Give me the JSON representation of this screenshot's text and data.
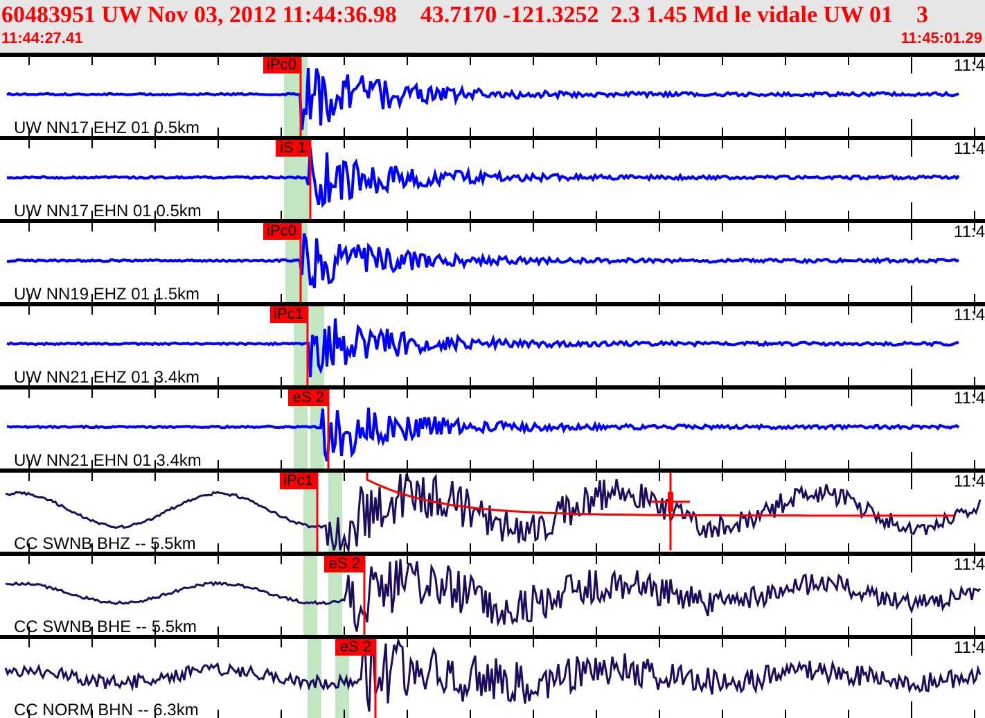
{
  "header": {
    "title": "60483951 UW Nov 03, 2012 11:44:36.98    43.7170 -121.3252  2.3 1.45 Md le vidale UW 01    3",
    "start_time": "11:44:27.41",
    "end_time": "11:45:01.29"
  },
  "channels": [
    {
      "kind": "short_period",
      "station": "UW NN17 EHZ 01 0.5km",
      "pick": "iPc0",
      "time_label": "11:4",
      "color": "#0000ff"
    },
    {
      "kind": "short_period",
      "station": "UW NN17 EHN 01 0.5km",
      "pick": "iS 1",
      "time_label": "11:4",
      "color": "#0000ff"
    },
    {
      "kind": "short_period",
      "station": "UW NN19 EHZ 01 1.5km",
      "pick": "iPc0",
      "time_label": "11:4",
      "color": "#0000ff"
    },
    {
      "kind": "short_period",
      "station": "UW NN21 EHZ 01 3.4km",
      "pick": "iPc1",
      "time_label": "11:4",
      "color": "#0000ff"
    },
    {
      "kind": "short_period",
      "station": "UW NN21 EHN 01 3.4km",
      "pick": "eS 2",
      "time_label": "11:4",
      "color": "#0000ff"
    },
    {
      "kind": "broadband",
      "station": "CC SWNB BHZ -- 5.5km",
      "pick": "iPc1",
      "time_label": "11:4",
      "color": "#1c0c5c",
      "coda": true
    },
    {
      "kind": "broadband",
      "station": "CC SWNB BHE -- 5.5km",
      "pick": "eS 2",
      "time_label": "11:4",
      "color": "#1c0c5c"
    },
    {
      "kind": "broadband",
      "station": "CC NORM BHN -- 6.3km",
      "pick": "eS 2",
      "time_label": "11:4",
      "color": "#1c0c5c"
    }
  ]
}
